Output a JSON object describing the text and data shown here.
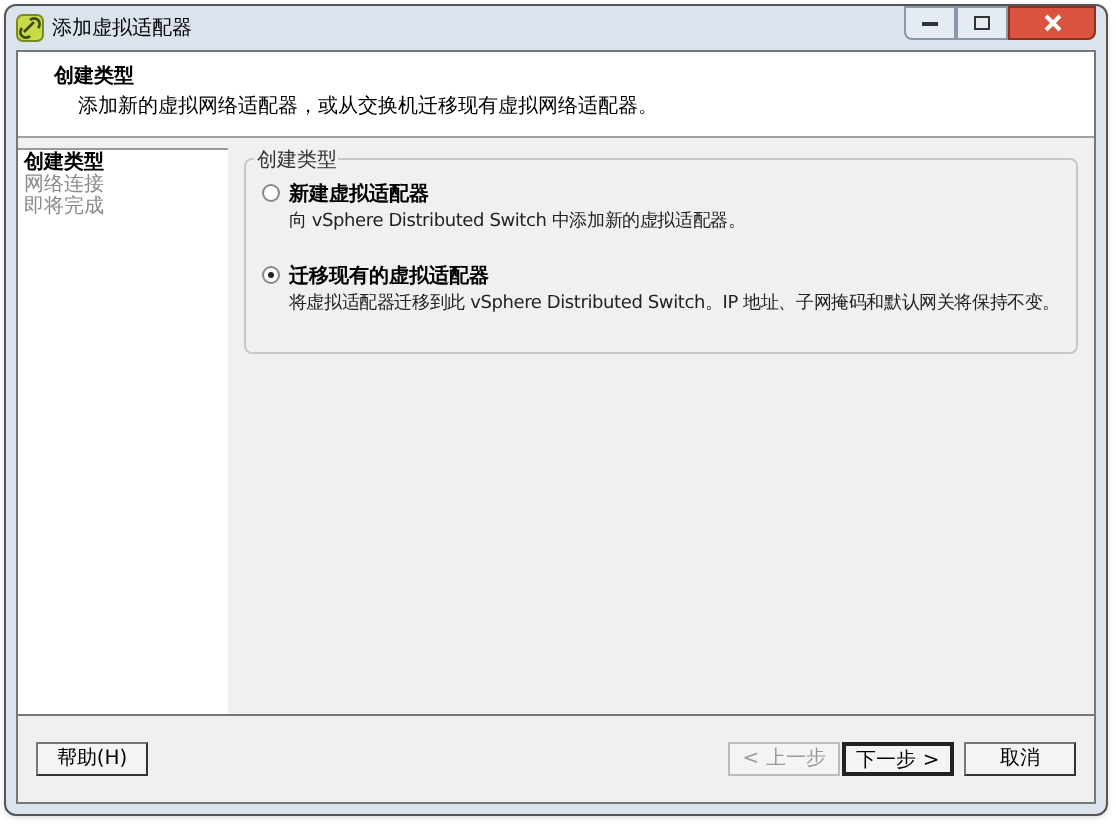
{
  "window": {
    "title": "添加虚拟适配器"
  },
  "header": {
    "title": "创建类型",
    "description": "添加新的虚拟网络适配器，或从交换机迁移现有虚拟网络适配器。"
  },
  "steps": [
    {
      "label": "创建类型",
      "selected": true
    },
    {
      "label": "网络连接",
      "selected": false
    },
    {
      "label": "即将完成",
      "selected": false
    }
  ],
  "group": {
    "title": "创建类型",
    "options": [
      {
        "label": "新建虚拟适配器",
        "description": "向 vSphere Distributed Switch 中添加新的虚拟适配器。",
        "selected": false
      },
      {
        "label": "迁移现有的虚拟适配器",
        "description": "将虚拟适配器迁移到此 vSphere Distributed Switch。IP 地址、子网掩码和默认网关将保持不变。",
        "selected": true
      }
    ]
  },
  "help_button": {
    "label": "帮助(H)"
  },
  "buttons": [
    {
      "label": "< 上一步",
      "disabled": true,
      "default": false
    },
    {
      "label": "下一步 >",
      "disabled": false,
      "default": true
    },
    {
      "label": "取消",
      "disabled": false,
      "default": false
    }
  ]
}
